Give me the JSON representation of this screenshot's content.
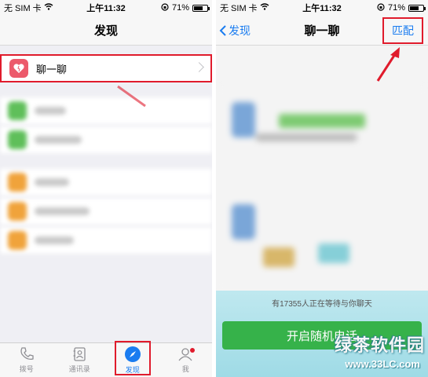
{
  "left": {
    "status": {
      "carrier": "无 SIM 卡",
      "time": "上午11:32",
      "battery": "71%",
      "battery_level": 0.71
    },
    "nav_title": "发现",
    "menu_item": {
      "label": "聊一聊",
      "icon": "heart-icon"
    },
    "tabs": [
      {
        "label": "拨号",
        "icon": "phone-icon"
      },
      {
        "label": "通讯录",
        "icon": "contacts-icon"
      },
      {
        "label": "发现",
        "icon": "compass-icon",
        "active": true
      },
      {
        "label": "我",
        "icon": "person-icon",
        "badge": true
      }
    ]
  },
  "right": {
    "status": {
      "carrier": "无 SIM 卡",
      "time": "上午11:32",
      "battery": "71%",
      "battery_level": 0.71
    },
    "back_label": "发现",
    "nav_title": "聊一聊",
    "match_label": "匹配",
    "waiting_text": "有17355人正在等待与你聊天",
    "start_button": "开启随机电话"
  },
  "watermark": {
    "text": "绿茶软件园",
    "url": "www.33LC.com"
  },
  "colors": {
    "accent": "#1a7cf0",
    "highlight": "#e01b2c",
    "green": "#36b24a",
    "chat_icon": "#ec5a6b"
  }
}
